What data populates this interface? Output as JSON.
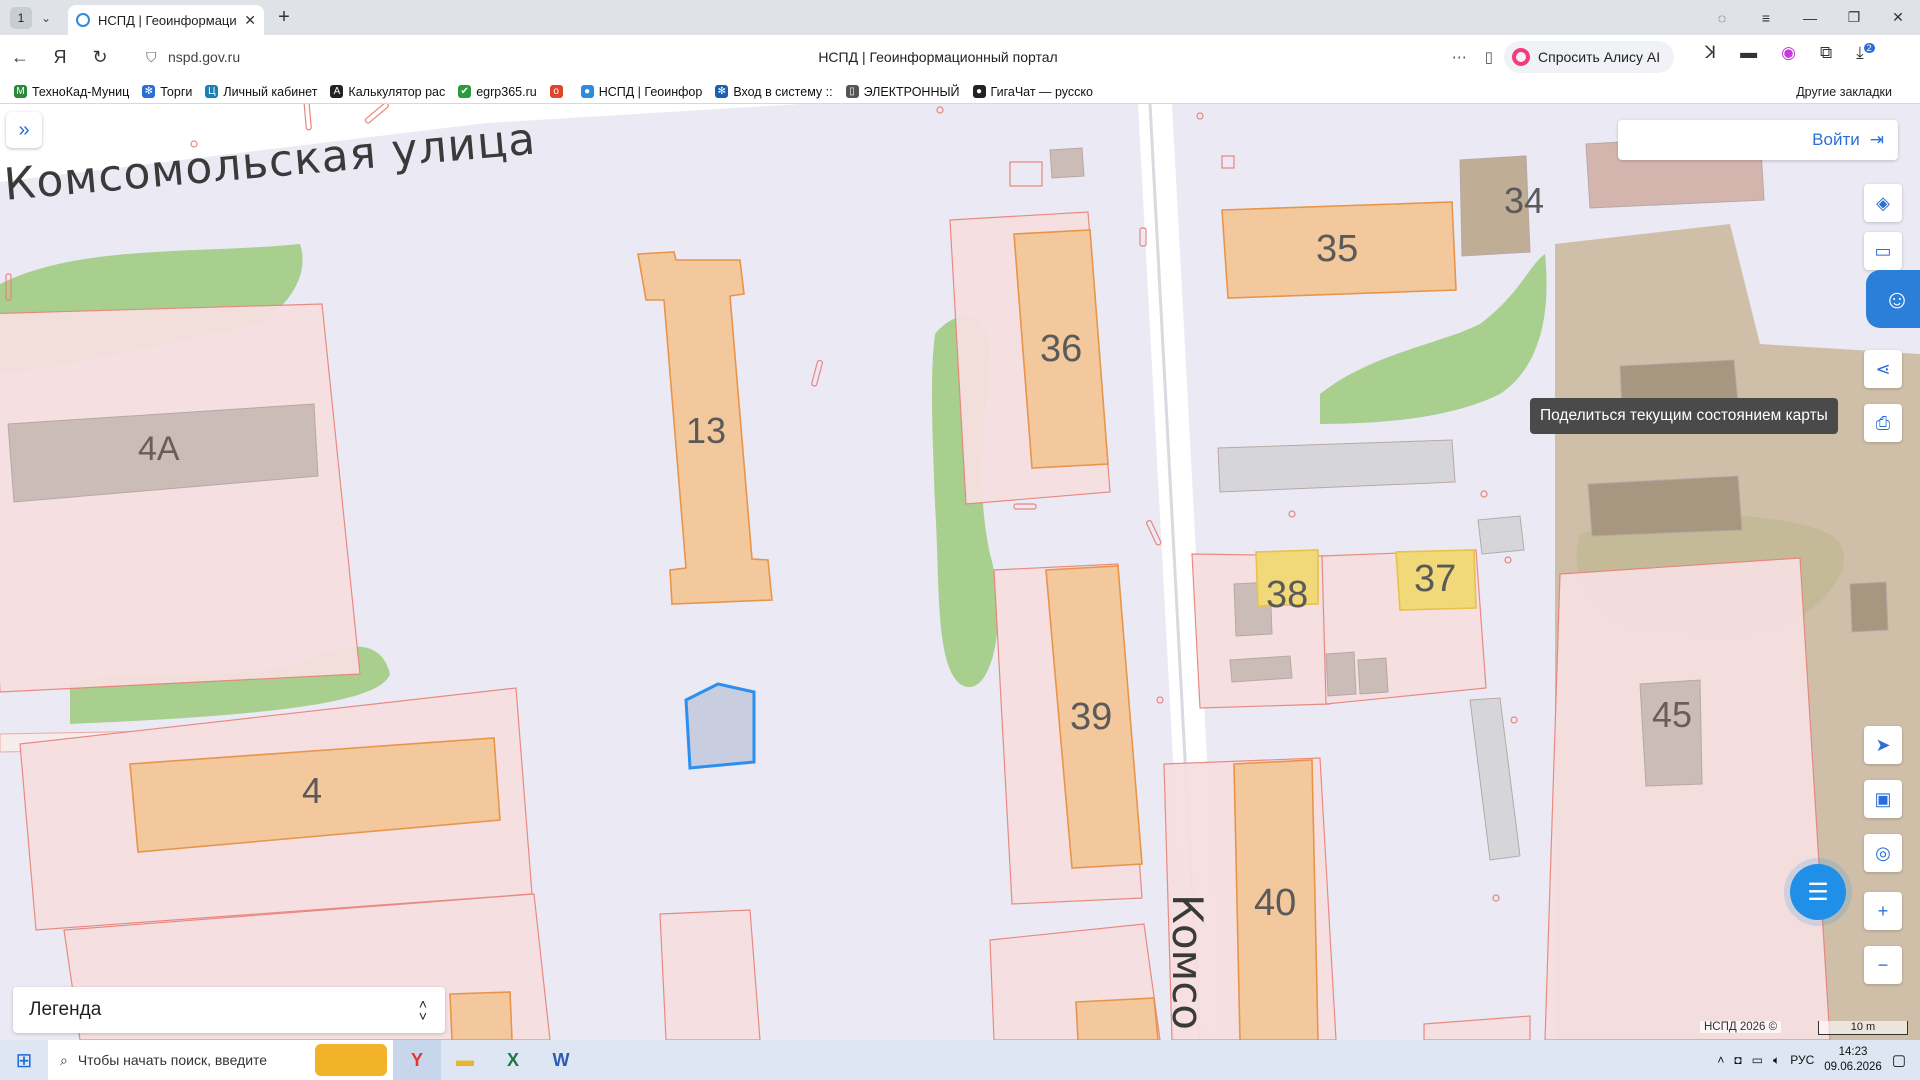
{
  "browser": {
    "tab_count": "1",
    "tab_title": "НСПД | Геоинформаци",
    "url": "nspd.gov.ru",
    "page_title": "НСПД | Геоинформационный портал",
    "alice_label": "Спросить Алису AI",
    "downloads_badge": "2"
  },
  "bookmarks": [
    {
      "label": "ТехноКад-Муниц",
      "color": "#2a8a3a",
      "glyph": "M"
    },
    {
      "label": "Торги",
      "color": "#2b6fd6",
      "glyph": "✻"
    },
    {
      "label": "Личный кабинет",
      "color": "#1b7fb4",
      "glyph": "Ц"
    },
    {
      "label": "Калькулятор рас",
      "color": "#222222",
      "glyph": "A"
    },
    {
      "label": "egrp365.ru",
      "color": "#2a9a3a",
      "glyph": "✔"
    },
    {
      "label": "",
      "color": "#e0442a",
      "glyph": "о"
    },
    {
      "label": "НСПД | Геоинфор",
      "color": "#2f8be0",
      "glyph": "●"
    },
    {
      "label": "Вход в систему ::",
      "color": "#1b5fb4",
      "glyph": "✻"
    },
    {
      "label": "ЭЛЕКТРОННЫЙ",
      "color": "#555555",
      "glyph": "▯"
    },
    {
      "label": "ГигаЧат — русско",
      "color": "#222222",
      "glyph": "●"
    }
  ],
  "bookmarks_other": "Другие закладки",
  "map": {
    "street_top": "Комсомольская улица",
    "street_vertical": "Комсо",
    "buildings": [
      "13",
      "34",
      "35",
      "36",
      "4А",
      "38",
      "37",
      "39",
      "45",
      "4",
      "40"
    ],
    "login_label": "Войти",
    "tooltip": "Поделиться текущим состоянием карты",
    "legend_label": "Легенда",
    "copyright": "НСПД 2026 ©",
    "scale": "10 m"
  },
  "taskbar": {
    "search_placeholder": "Чтобы начать поиск, введите",
    "lang": "РУС",
    "time": "14:23",
    "date": "09.06.2026"
  },
  "colors": {
    "parcel_fill": "#f6dfe0",
    "parcel_stroke": "#e9857c",
    "building_fill": "#f3c89c",
    "building_stroke": "#e8954a",
    "green": "#a9cf8e",
    "selected": "#2b8ff0",
    "accent": "#2b6fd6"
  }
}
